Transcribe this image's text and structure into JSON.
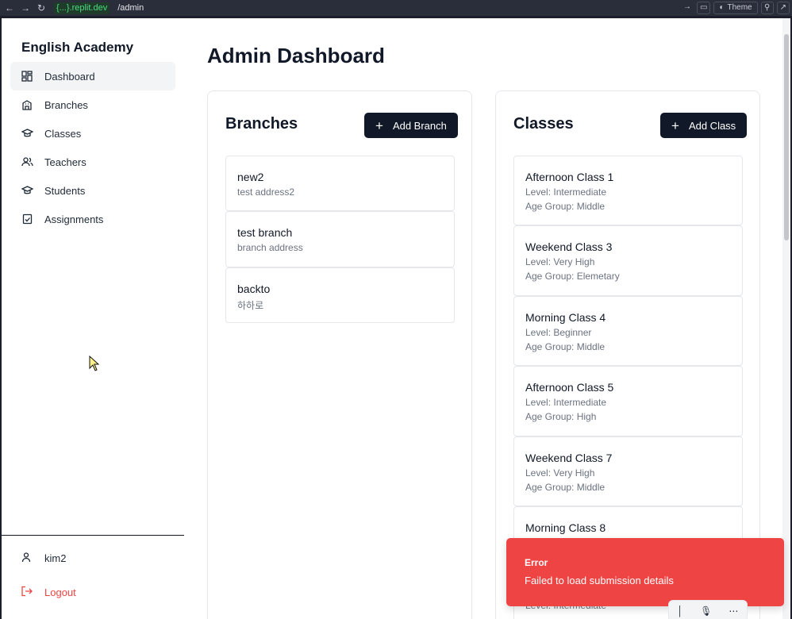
{
  "browser": {
    "host": "{...}.replit.dev",
    "path": "/admin",
    "theme_label": "Theme"
  },
  "sidebar": {
    "brand": "English Academy",
    "items": [
      {
        "label": "Dashboard",
        "icon": "dashboard-icon",
        "active": true
      },
      {
        "label": "Branches",
        "icon": "building-icon"
      },
      {
        "label": "Classes",
        "icon": "graduation-cap-icon"
      },
      {
        "label": "Teachers",
        "icon": "users-icon"
      },
      {
        "label": "Students",
        "icon": "graduation-cap-icon"
      },
      {
        "label": "Assignments",
        "icon": "clipboard-check-icon"
      }
    ],
    "user": "kim2",
    "logout": "Logout"
  },
  "main": {
    "title": "Admin Dashboard",
    "branches": {
      "title": "Branches",
      "add_label": "Add Branch",
      "items": [
        {
          "name": "new2",
          "address": "test address2"
        },
        {
          "name": "test branch",
          "address": "branch address"
        },
        {
          "name": "backto",
          "address": "하하로"
        }
      ]
    },
    "classes": {
      "title": "Classes",
      "add_label": "Add Class",
      "items": [
        {
          "name": "Afternoon Class 1",
          "level": "Level: Intermediate",
          "age": "Age Group: Middle"
        },
        {
          "name": "Weekend Class 3",
          "level": "Level: Very High",
          "age": "Age Group: Elemetary"
        },
        {
          "name": "Morning Class 4",
          "level": "Level: Beginner",
          "age": "Age Group: Middle"
        },
        {
          "name": "Afternoon Class 5",
          "level": "Level: Intermediate",
          "age": "Age Group: High"
        },
        {
          "name": "Weekend Class 7",
          "level": "Level: Very High",
          "age": "Age Group: Middle"
        },
        {
          "name": "Morning Class 8",
          "level": "Level: Intermediate",
          "age": ""
        }
      ]
    }
  },
  "toast": {
    "title": "Error",
    "message": "Failed to load submission details"
  },
  "colors": {
    "primary_button": "#111827",
    "error": "#ef4444",
    "active_nav_bg": "#f3f4f6"
  }
}
